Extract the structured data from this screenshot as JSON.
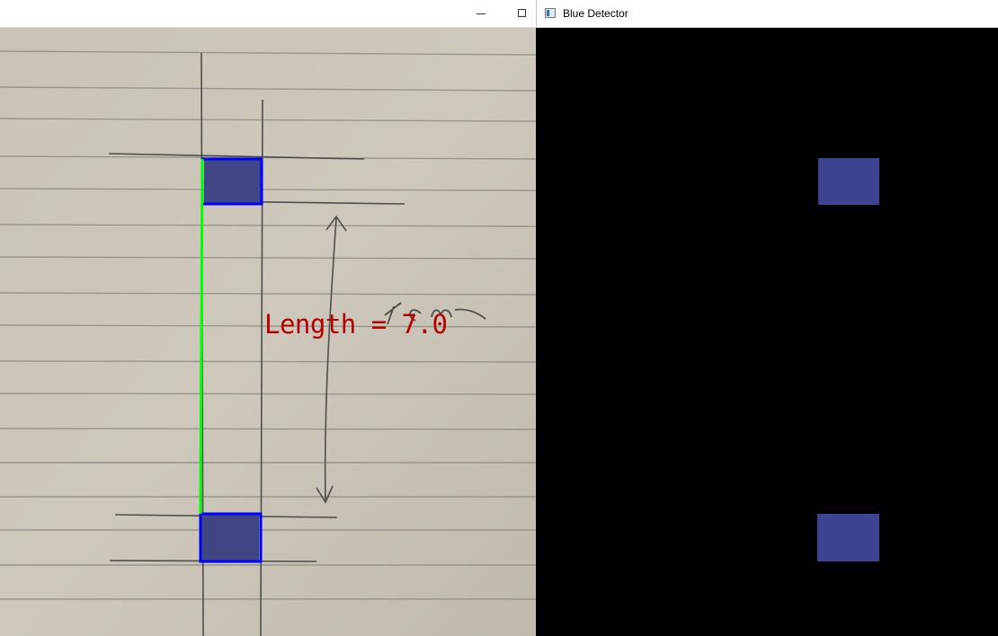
{
  "left_window": {
    "title": "",
    "controls": {
      "minimize": "minimize",
      "maximize": "maximize"
    },
    "overlay": {
      "measurement_text": "Length = 7.0",
      "text_color": "#b50000",
      "box_color": "#0000ff",
      "line_color": "#00ff00"
    },
    "handwriting": "7cm"
  },
  "right_window": {
    "title": "Blue Detector",
    "background": "#000000",
    "blob_color": "#3d4391"
  },
  "colors": {
    "paper": "#cbc6b8",
    "rule_line": "#8a8a8a",
    "pencil": "#555555"
  }
}
